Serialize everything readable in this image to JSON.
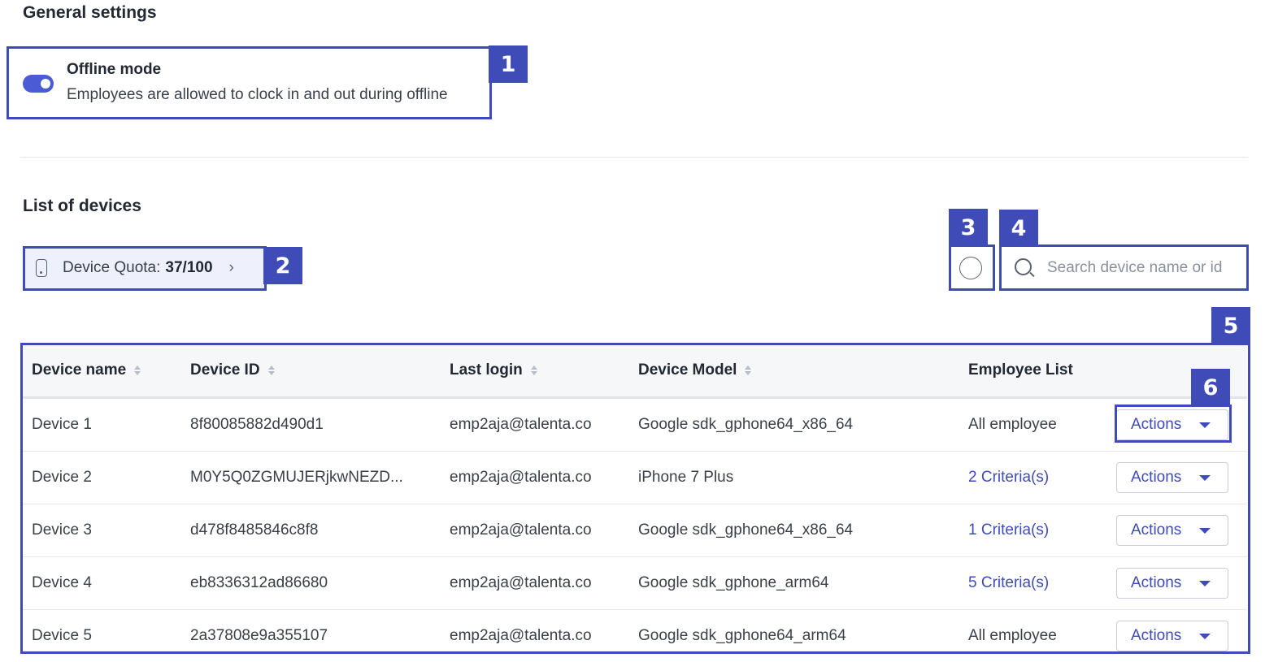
{
  "general": {
    "title": "General settings",
    "offline_mode": {
      "title": "Offline mode",
      "description": "Employees are allowed to clock in and out during offline",
      "enabled": true
    }
  },
  "devices": {
    "title": "List of devices",
    "quota": {
      "label": "Device Quota:",
      "value": "37/100"
    },
    "search": {
      "placeholder": "Search device name or id"
    },
    "help_glyph": "?",
    "columns": [
      "Device name",
      "Device ID",
      "Last login",
      "Device Model",
      "Employee List"
    ],
    "rows": [
      {
        "name": "Device 1",
        "id": "8f80085882d490d1",
        "login": "emp2aja@talenta.co",
        "model": "Google sdk_gphone64_x86_64",
        "employees": "All employee",
        "employees_link": false,
        "action": "Actions"
      },
      {
        "name": "Device 2",
        "id": "M0Y5Q0ZGMUJERjkwNEZD...",
        "login": "emp2aja@talenta.co",
        "model": "iPhone 7 Plus",
        "employees": "2 Criteria(s)",
        "employees_link": true,
        "action": "Actions"
      },
      {
        "name": "Device 3",
        "id": "d478f8485846c8f8",
        "login": "emp2aja@talenta.co",
        "model": "Google sdk_gphone64_x86_64",
        "employees": "1 Criteria(s)",
        "employees_link": true,
        "action": "Actions"
      },
      {
        "name": "Device 4",
        "id": "eb8336312ad86680",
        "login": "emp2aja@talenta.co",
        "model": "Google sdk_gphone_arm64",
        "employees": "5 Criteria(s)",
        "employees_link": true,
        "action": "Actions"
      },
      {
        "name": "Device 5",
        "id": "2a37808e9a355107",
        "login": "emp2aja@talenta.co",
        "model": "Google sdk_gphone64_arm64",
        "employees": "All employee",
        "employees_link": false,
        "action": "Actions"
      }
    ]
  },
  "annotations": [
    "1",
    "2",
    "3",
    "4",
    "5",
    "6"
  ],
  "colors": {
    "accent": "#3f4bb6",
    "toggle_on": "#4b5bd6",
    "text": "#232933"
  },
  "icons": {
    "quota": "phone-icon",
    "quota_arrow": "chevron-right-icon",
    "help": "help-circle-icon",
    "search": "search-icon",
    "sort": "sort-icon",
    "actions": "caret-down-icon"
  }
}
